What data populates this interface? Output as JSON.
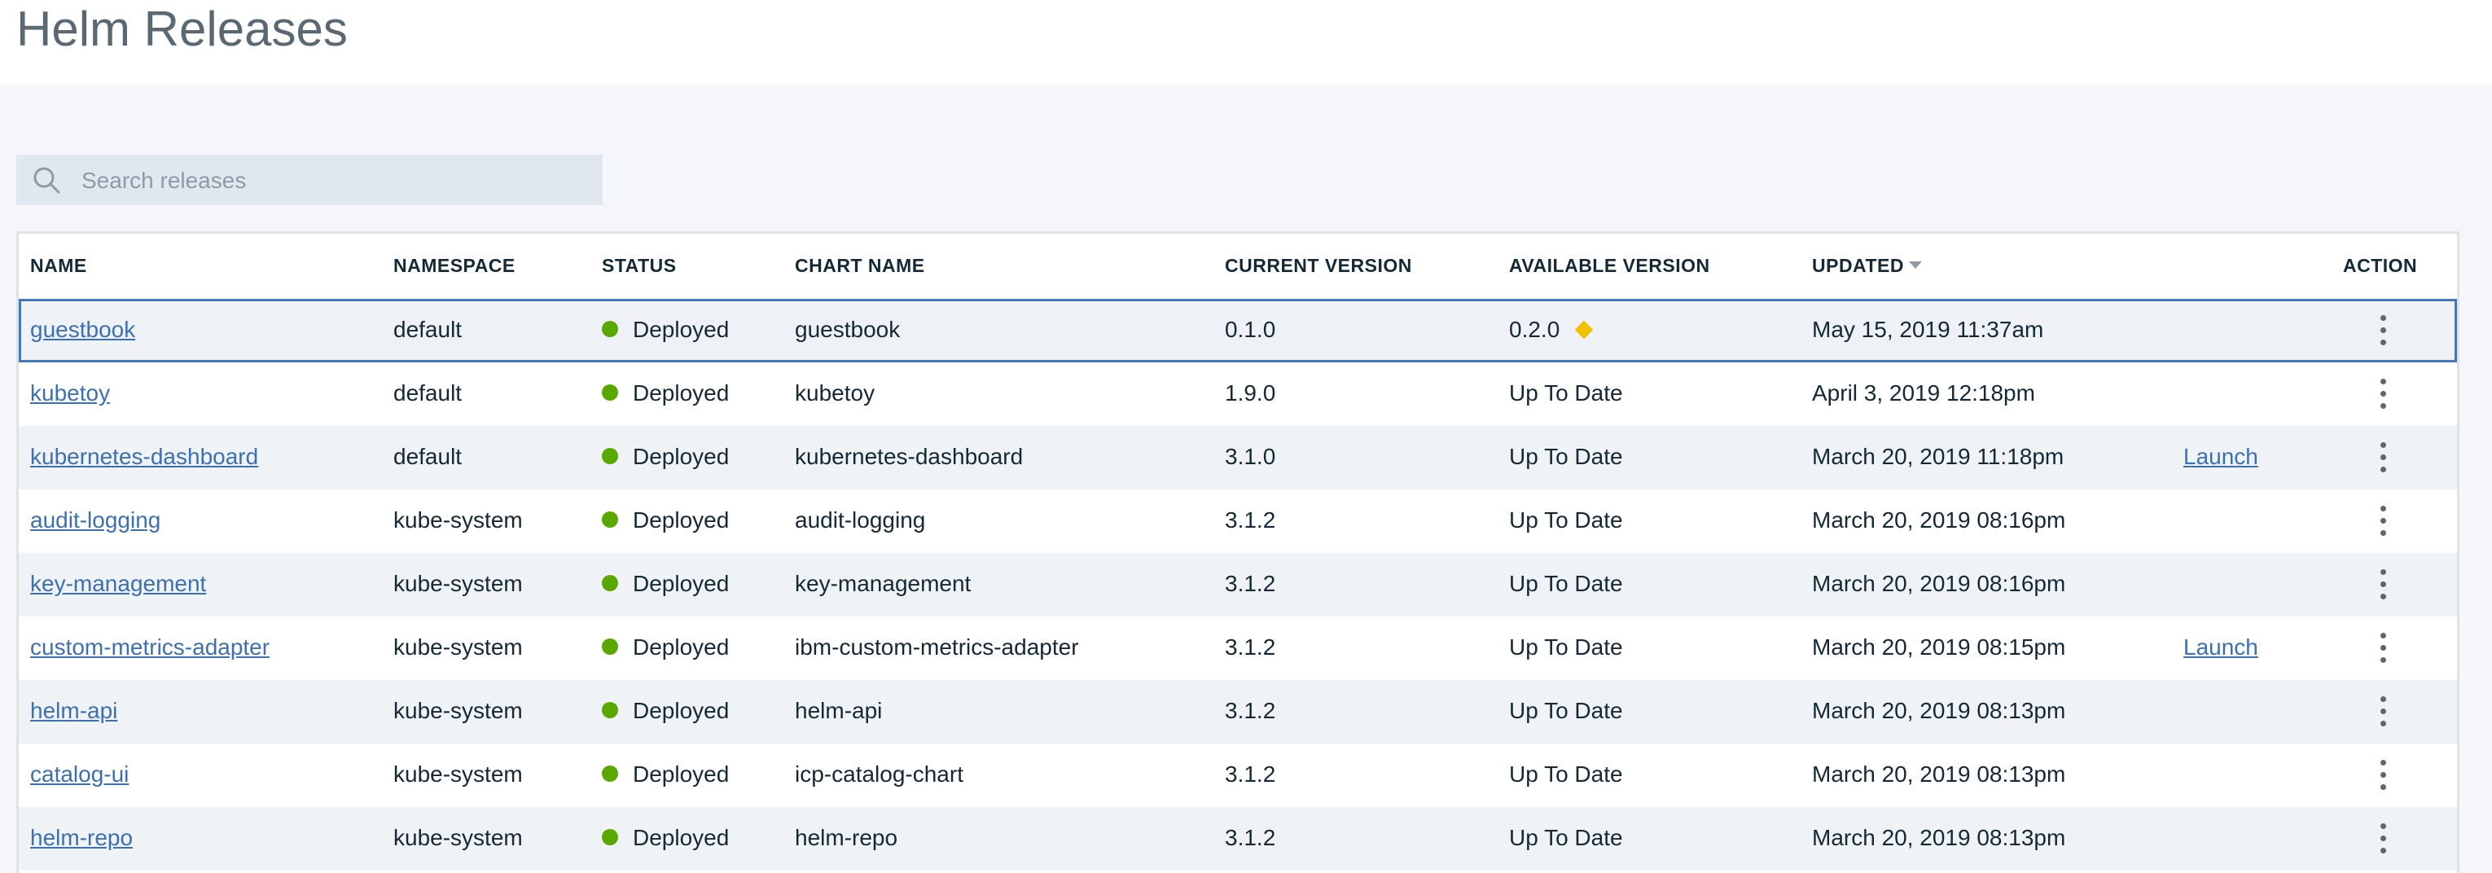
{
  "page": {
    "title": "Helm Releases"
  },
  "search": {
    "placeholder": "Search releases",
    "icon": "search-icon"
  },
  "table": {
    "columns": {
      "name": "NAME",
      "namespace": "NAMESPACE",
      "status": "STATUS",
      "chart_name": "CHART NAME",
      "current_version": "CURRENT VERSION",
      "available_version": "AVAILABLE VERSION",
      "updated": "UPDATED",
      "action": "ACTION"
    },
    "sorted_column": "updated",
    "rows": [
      {
        "name": "guestbook",
        "namespace": "default",
        "status": "Deployed",
        "chart": "guestbook",
        "current": "0.1.0",
        "available": "0.2.0",
        "update_available": true,
        "updated": "May 15, 2019 11:37am",
        "launch": ""
      },
      {
        "name": "kubetoy",
        "namespace": "default",
        "status": "Deployed",
        "chart": "kubetoy",
        "current": "1.9.0",
        "available": "Up To Date",
        "update_available": false,
        "updated": "April 3, 2019 12:18pm",
        "launch": ""
      },
      {
        "name": "kubernetes-dashboard",
        "namespace": "default",
        "status": "Deployed",
        "chart": "kubernetes-dashboard",
        "current": "3.1.0",
        "available": "Up To Date",
        "update_available": false,
        "updated": "March 20, 2019 11:18pm",
        "launch": "Launch"
      },
      {
        "name": "audit-logging",
        "namespace": "kube-system",
        "status": "Deployed",
        "chart": "audit-logging",
        "current": "3.1.2",
        "available": "Up To Date",
        "update_available": false,
        "updated": "March 20, 2019 08:16pm",
        "launch": ""
      },
      {
        "name": "key-management",
        "namespace": "kube-system",
        "status": "Deployed",
        "chart": "key-management",
        "current": "3.1.2",
        "available": "Up To Date",
        "update_available": false,
        "updated": "March 20, 2019 08:16pm",
        "launch": ""
      },
      {
        "name": "custom-metrics-adapter",
        "namespace": "kube-system",
        "status": "Deployed",
        "chart": "ibm-custom-metrics-adapter",
        "current": "3.1.2",
        "available": "Up To Date",
        "update_available": false,
        "updated": "March 20, 2019 08:15pm",
        "launch": "Launch"
      },
      {
        "name": "helm-api",
        "namespace": "kube-system",
        "status": "Deployed",
        "chart": "helm-api",
        "current": "3.1.2",
        "available": "Up To Date",
        "update_available": false,
        "updated": "March 20, 2019 08:13pm",
        "launch": ""
      },
      {
        "name": "catalog-ui",
        "namespace": "kube-system",
        "status": "Deployed",
        "chart": "icp-catalog-chart",
        "current": "3.1.2",
        "available": "Up To Date",
        "update_available": false,
        "updated": "March 20, 2019 08:13pm",
        "launch": ""
      },
      {
        "name": "helm-repo",
        "namespace": "kube-system",
        "status": "Deployed",
        "chart": "helm-repo",
        "current": "3.1.2",
        "available": "Up To Date",
        "update_available": false,
        "updated": "March 20, 2019 08:13pm",
        "launch": ""
      }
    ]
  },
  "colors": {
    "status_deployed": "#5aa700",
    "update_available": "#efc100",
    "link": "#3d70b2",
    "selected_border": "#4178be"
  }
}
